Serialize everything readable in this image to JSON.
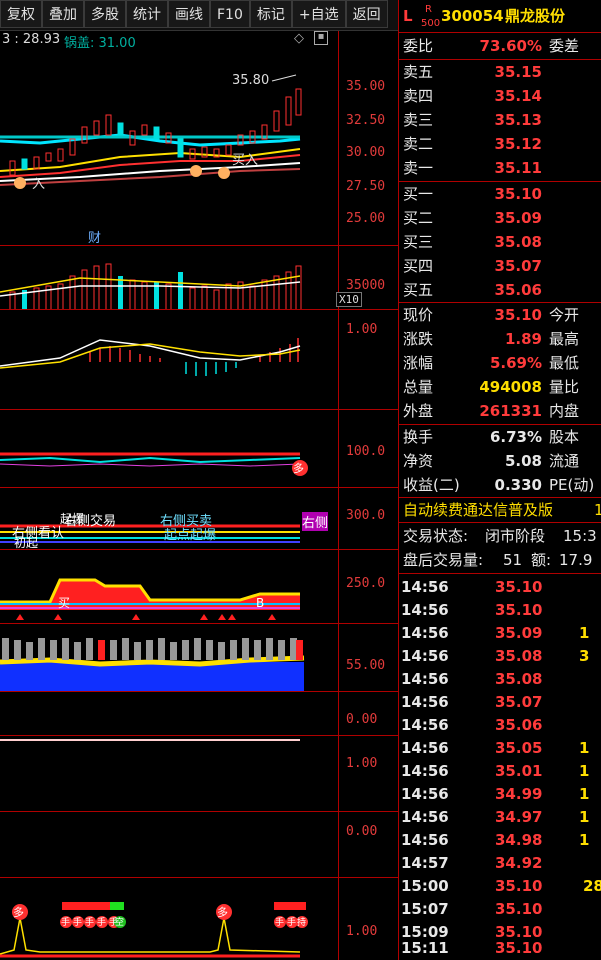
{
  "toolbar": {
    "buttons": [
      "复权",
      "叠加",
      "多股",
      "统计",
      "画线",
      "F10",
      "标记",
      "+自选",
      "返回"
    ]
  },
  "chart_header": {
    "price_text": "3 : 28.93",
    "indicator_label": "锅盖: 31.00"
  },
  "main_chart": {
    "high_marker": "35.80",
    "axis": [
      "35.00",
      "32.50",
      "30.00",
      "27.50",
      "25.00"
    ],
    "labels": {
      "buy_in": "买入",
      "left_buy": "入",
      "cai": "财"
    }
  },
  "volume_panel": {
    "axis": [
      "35000",
      "X10"
    ]
  },
  "macd_panel": {
    "axis": [
      "1.00"
    ]
  },
  "panel4": {
    "axis": [
      "100.0"
    ],
    "badge": "多"
  },
  "panel5": {
    "axis": [
      "300.0"
    ],
    "labels": [
      "右侧看认",
      "右侧交易",
      "右侧买卖",
      "起点起爆",
      "起爆",
      "右侧",
      "初起"
    ]
  },
  "panel6": {
    "axis": [
      "250.0"
    ],
    "badge_a": "买",
    "badge_b": "B"
  },
  "panel7": {
    "axis": [
      "55.00"
    ]
  },
  "panel8": {
    "axis": [
      "0.00"
    ]
  },
  "panel9": {
    "axis": [
      "1.00"
    ]
  },
  "panel10": {
    "axis": [
      "0.00"
    ]
  },
  "panel11": {
    "axis": [
      "1.00"
    ],
    "badges": [
      "多",
      "多"
    ],
    "small_labels": [
      "手",
      "手",
      "手",
      "手",
      "手",
      "空",
      "手",
      "手",
      "持"
    ]
  },
  "quote": {
    "market_tag": "L",
    "r_tag": "R",
    "index_tag": "500",
    "code": "300054",
    "name": "鼎龙股份",
    "weibi_label": "委比",
    "weibi_value": "73.60%",
    "weicha_label": "委差",
    "asks": [
      {
        "label": "卖五",
        "price": "35.15"
      },
      {
        "label": "卖四",
        "price": "35.14"
      },
      {
        "label": "卖三",
        "price": "35.13"
      },
      {
        "label": "卖二",
        "price": "35.12"
      },
      {
        "label": "卖一",
        "price": "35.11"
      }
    ],
    "bids": [
      {
        "label": "买一",
        "price": "35.10"
      },
      {
        "label": "买二",
        "price": "35.09"
      },
      {
        "label": "买三",
        "price": "35.08"
      },
      {
        "label": "买四",
        "price": "35.07"
      },
      {
        "label": "买五",
        "price": "35.06"
      }
    ],
    "stats": [
      {
        "label": "现价",
        "value": "35.10",
        "label2": "今开",
        "color": "red"
      },
      {
        "label": "涨跌",
        "value": "1.89",
        "label2": "最高",
        "color": "red"
      },
      {
        "label": "涨幅",
        "value": "5.69%",
        "label2": "最低",
        "color": "red"
      },
      {
        "label": "总量",
        "value": "494008",
        "label2": "量比",
        "color": "yellow"
      },
      {
        "label": "外盘",
        "value": "261331",
        "label2": "内盘",
        "color": "red"
      }
    ],
    "stats2": [
      {
        "label": "换手",
        "value": "6.73%",
        "label2": "股本",
        "color": "white"
      },
      {
        "label": "净资",
        "value": "5.08",
        "label2": "流通",
        "color": "white"
      },
      {
        "label": "收益(二)",
        "value": "0.330",
        "label2": "PE(动)",
        "color": "white"
      }
    ],
    "banner": "自动续费通达信普及版",
    "banner_tail": "1",
    "trade_state_label": "交易状态:",
    "trade_state": "闭市阶段",
    "trade_state_time": "15:3",
    "after_volume_label": "盘后交易量:",
    "after_volume": "51",
    "after_amount_label": "额:",
    "after_amount": "17.9",
    "ticks": [
      {
        "time": "14:56",
        "price": "35.10",
        "vol": ""
      },
      {
        "time": "14:56",
        "price": "35.10",
        "vol": ""
      },
      {
        "time": "14:56",
        "price": "35.09",
        "vol": "1"
      },
      {
        "time": "14:56",
        "price": "35.08",
        "vol": "3"
      },
      {
        "time": "14:56",
        "price": "35.08",
        "vol": ""
      },
      {
        "time": "14:56",
        "price": "35.07",
        "vol": ""
      },
      {
        "time": "14:56",
        "price": "35.06",
        "vol": ""
      },
      {
        "time": "14:56",
        "price": "35.05",
        "vol": "1"
      },
      {
        "time": "14:56",
        "price": "35.01",
        "vol": "1"
      },
      {
        "time": "14:56",
        "price": "34.99",
        "vol": "1"
      },
      {
        "time": "14:56",
        "price": "34.97",
        "vol": "1"
      },
      {
        "time": "14:56",
        "price": "34.98",
        "vol": "1"
      },
      {
        "time": "14:57",
        "price": "34.92",
        "vol": ""
      },
      {
        "time": "15:00",
        "price": "35.10",
        "vol": "28"
      },
      {
        "time": "15:07",
        "price": "35.10",
        "vol": ""
      },
      {
        "time": "15:09",
        "price": "35.10",
        "vol": ""
      },
      {
        "time": "15:11",
        "price": "35.10",
        "vol": ""
      }
    ]
  }
}
